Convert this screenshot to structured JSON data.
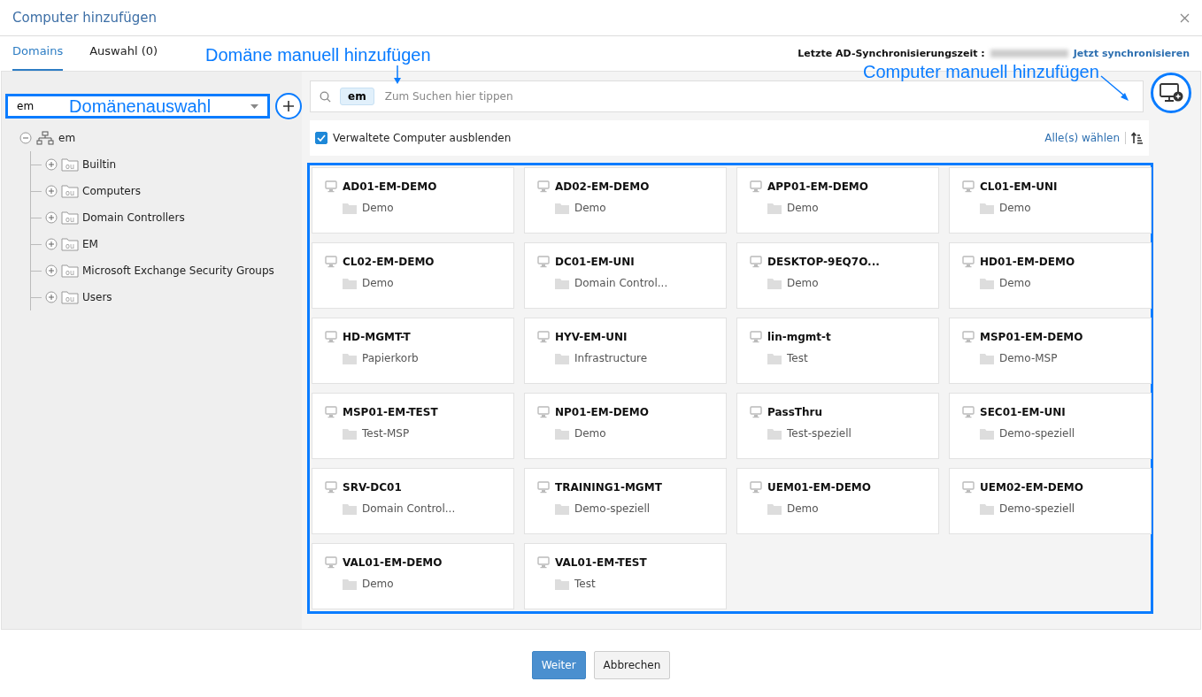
{
  "window": {
    "title": "Computer hinzufügen"
  },
  "tabs": [
    {
      "label": "Domains",
      "selected": true
    },
    {
      "label": "Auswahl (0)",
      "selected": false
    }
  ],
  "sync": {
    "label": "Letzte AD-Synchronisierungszeit :",
    "link": "Jetzt synchronisieren"
  },
  "domain_select": {
    "value": "em"
  },
  "tree": {
    "label": "em",
    "expanded": true,
    "children": [
      {
        "label": "Builtin",
        "badge": "ou",
        "expanded": false
      },
      {
        "label": "Computers",
        "badge": "ou",
        "expanded": false
      },
      {
        "label": "Domain Controllers",
        "badge": "ou",
        "expanded": false
      },
      {
        "label": "EM",
        "badge": "ou",
        "expanded": false
      },
      {
        "label": "Microsoft Exchange Security Groups",
        "badge": "ou",
        "expanded": false
      },
      {
        "label": "Users",
        "badge": "ou",
        "expanded": false
      }
    ]
  },
  "search": {
    "chip": "em",
    "placeholder": "Zum Suchen hier tippen"
  },
  "hide_managed": {
    "label": "Verwaltete Computer ausblenden",
    "checked": true
  },
  "select_all": "Alle(s) wählen",
  "computers": [
    {
      "name": "AD01-EM-DEMO",
      "ou": "Demo"
    },
    {
      "name": "AD02-EM-DEMO",
      "ou": "Demo"
    },
    {
      "name": "APP01-EM-DEMO",
      "ou": "Demo"
    },
    {
      "name": "CL01-EM-UNI",
      "ou": "Demo"
    },
    {
      "name": "CL02-EM-DEMO",
      "ou": "Demo"
    },
    {
      "name": "DC01-EM-UNI",
      "ou": "Domain Control..."
    },
    {
      "name": "DESKTOP-9EQ7O...",
      "ou": "Demo"
    },
    {
      "name": "HD01-EM-DEMO",
      "ou": "Demo"
    },
    {
      "name": "HD-MGMT-T",
      "ou": "Papierkorb"
    },
    {
      "name": "HYV-EM-UNI",
      "ou": "Infrastructure"
    },
    {
      "name": "lin-mgmt-t",
      "ou": "Test"
    },
    {
      "name": "MSP01-EM-DEMO",
      "ou": "Demo-MSP"
    },
    {
      "name": "MSP01-EM-TEST",
      "ou": "Test-MSP"
    },
    {
      "name": "NP01-EM-DEMO",
      "ou": "Demo"
    },
    {
      "name": "PassThru",
      "ou": "Test-speziell"
    },
    {
      "name": "SEC01-EM-UNI",
      "ou": "Demo-speziell"
    },
    {
      "name": "SRV-DC01",
      "ou": "Domain Control..."
    },
    {
      "name": "TRAINING1-MGMT",
      "ou": "Demo-speziell"
    },
    {
      "name": "UEM01-EM-DEMO",
      "ou": "Demo"
    },
    {
      "name": "UEM02-EM-DEMO",
      "ou": "Demo-speziell"
    },
    {
      "name": "VAL01-EM-DEMO",
      "ou": "Demo"
    },
    {
      "name": "VAL01-EM-TEST",
      "ou": "Test"
    }
  ],
  "annotations": {
    "domain_add": "Domäne manuell hinzufügen",
    "domain_select": "Domänenauswahl",
    "computer_add": "Computer manuell hinzufügen"
  },
  "buttons": [
    {
      "label": "Weiter",
      "kind": "primary"
    },
    {
      "label": "Abbrechen",
      "kind": "secondary"
    }
  ]
}
